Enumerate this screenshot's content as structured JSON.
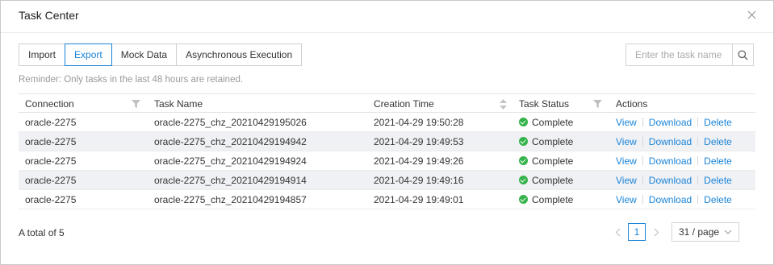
{
  "dialog": {
    "title": "Task Center"
  },
  "tabs": [
    {
      "label": "Import"
    },
    {
      "label": "Export"
    },
    {
      "label": "Mock Data"
    },
    {
      "label": "Asynchronous Execution"
    }
  ],
  "search": {
    "placeholder": "Enter the task name"
  },
  "reminder": "Reminder: Only tasks in the last 48 hours are retained.",
  "table": {
    "headers": {
      "connection": "Connection",
      "task_name": "Task Name",
      "creation_time": "Creation Time",
      "task_status": "Task Status",
      "actions": "Actions"
    },
    "rows": [
      {
        "connection": "oracle-2275",
        "task_name": "oracle-2275_chz_20210429195026",
        "creation_time": "2021-04-29 19:50:28",
        "status": "Complete"
      },
      {
        "connection": "oracle-2275",
        "task_name": "oracle-2275_chz_20210429194942",
        "creation_time": "2021-04-29 19:49:53",
        "status": "Complete"
      },
      {
        "connection": "oracle-2275",
        "task_name": "oracle-2275_chz_20210429194924",
        "creation_time": "2021-04-29 19:49:26",
        "status": "Complete"
      },
      {
        "connection": "oracle-2275",
        "task_name": "oracle-2275_chz_20210429194914",
        "creation_time": "2021-04-29 19:49:16",
        "status": "Complete"
      },
      {
        "connection": "oracle-2275",
        "task_name": "oracle-2275_chz_20210429194857",
        "creation_time": "2021-04-29 19:49:01",
        "status": "Complete"
      }
    ],
    "actions": {
      "view": "View",
      "download": "Download",
      "delete": "Delete"
    }
  },
  "footer": {
    "total": "A total of 5"
  },
  "pagination": {
    "current_page": "1",
    "page_size": "31 / page"
  },
  "colors": {
    "accent": "#1a84d8",
    "success": "#35b34a",
    "stripe": "#f0f1f4"
  }
}
